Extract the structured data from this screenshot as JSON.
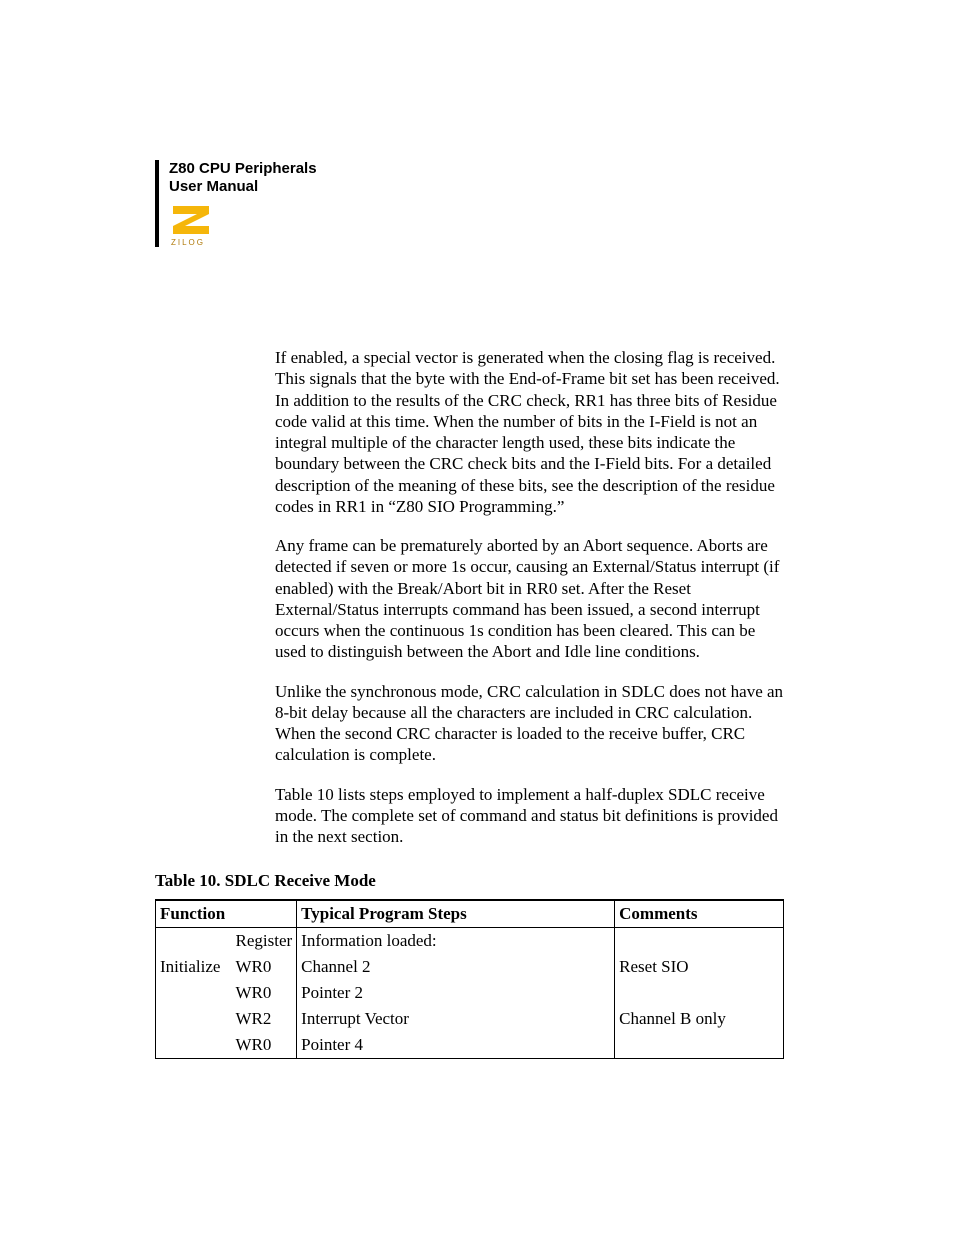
{
  "header": {
    "title_line1": "Z80 CPU Peripherals",
    "title_line2": "User Manual",
    "logo_word": "ZILOG"
  },
  "paragraphs": {
    "p1": "If enabled, a special vector is generated when the closing flag is received. This signals that the byte with the End-of-Frame bit set has been received. In addition to the results of the CRC check, RR1 has three bits of Residue code valid at this time. When the number of bits in the I-Field is not an integral multiple of the character length used, these bits indicate the boundary between the CRC check bits and the I-Field bits. For a detailed description of the meaning of these bits, see the description of the residue codes in RR1 in “Z80 SIO Programming.”",
    "p2": "Any frame can be prematurely aborted by an Abort sequence. Aborts are detected if seven or more 1s occur, causing an External/Status interrupt (if enabled) with the Break/Abort bit in RR0 set. After the Reset External/Status interrupts command has been issued, a second interrupt occurs when the continuous 1s condition has been cleared. This can be used to distinguish between the Abort and Idle line conditions.",
    "p3": "Unlike the synchronous mode, CRC calculation in SDLC does not have an 8-bit delay because all the characters are included in CRC calculation. When the second CRC character is loaded to the receive buffer, CRC calculation is complete.",
    "p4": "Table 10 lists steps employed to implement a half-duplex SDLC receive mode. The complete set of command and status bit definitions is provided in the next section."
  },
  "table": {
    "caption": "Table 10. SDLC Receive Mode",
    "headers": {
      "function": "Function",
      "typical": "Typical Program Steps",
      "comments": "Comments"
    },
    "subheaders": {
      "register": "Register",
      "info": "Information loaded:"
    },
    "rows": [
      {
        "function": "Initialize",
        "register": "WR0",
        "step": "Channel 2",
        "comment": "Reset SIO"
      },
      {
        "function": "",
        "register": "WR0",
        "step": "Pointer 2",
        "comment": ""
      },
      {
        "function": "",
        "register": "WR2",
        "step": "Interrupt Vector",
        "comment": "Channel B only"
      },
      {
        "function": "",
        "register": "WR0",
        "step": "Pointer 4",
        "comment": ""
      }
    ]
  }
}
